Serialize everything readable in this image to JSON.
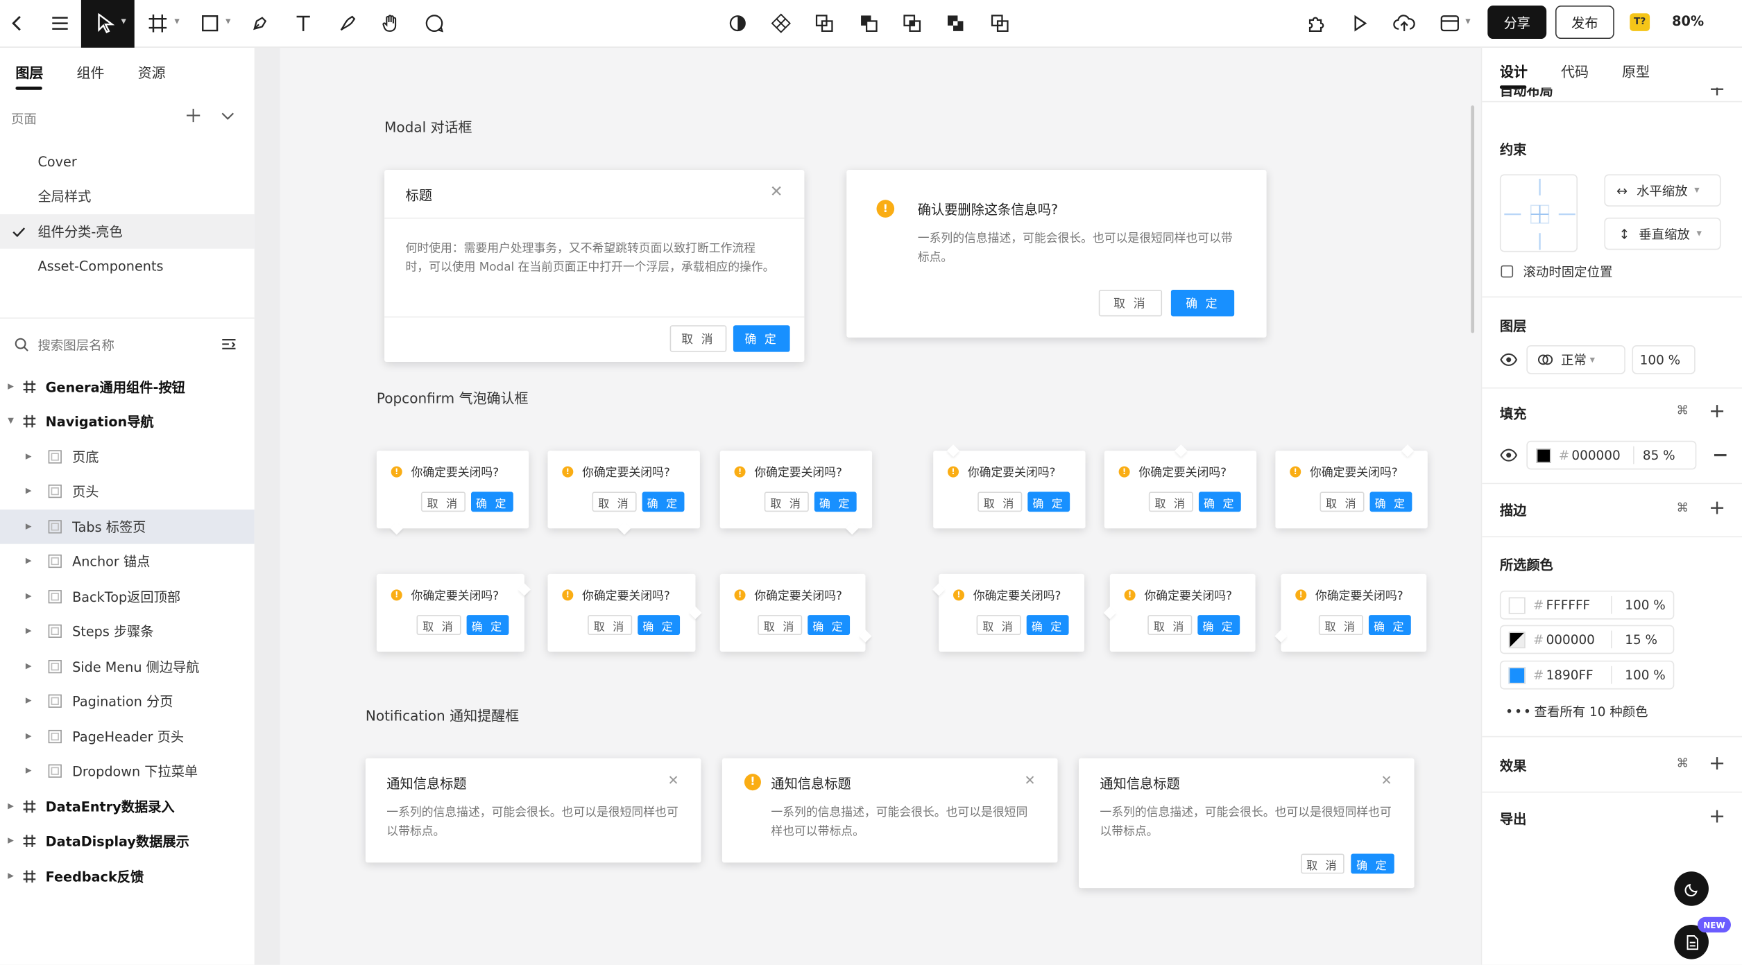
{
  "toolbar": {
    "share_label": "分享",
    "publish_label": "发布",
    "zoom": "80%",
    "font_badge": "T?"
  },
  "left": {
    "tabs": [
      "图层",
      "组件",
      "资源"
    ],
    "pages_label": "页面",
    "pages": [
      "Cover",
      "全局样式",
      "组件分类-亮色",
      "Asset-Components"
    ],
    "search_placeholder": "搜索图层名称",
    "layers": [
      "Genera通用组件-按钮",
      "Navigation导航",
      "页底",
      "页头",
      "Tabs 标签页",
      "Anchor 锚点",
      "BackTop返回顶部",
      "Steps 步骤条",
      "Side Menu 侧边导航",
      "Pagination 分页",
      "PageHeader 页头",
      "Dropdown 下拉菜单",
      "DataEntry数据录入",
      "DataDisplay数据展示",
      "Feedback反馈"
    ]
  },
  "canvas": {
    "modal_section": "Modal 对话框",
    "modal1": {
      "title": "标题",
      "body": "何时使用：需要用户处理事务，又不希望跳转页面以致打断工作流程时，可以使用 Modal 在当前页面正中打开一个浮层，承载相应的操作。",
      "cancel": "取 消",
      "ok": "确 定"
    },
    "modal2": {
      "title": "确认要删除这条信息吗?",
      "body": "一系列的信息描述，可能会很长。也可以是很短同样也可以带标点。",
      "cancel": "取 消",
      "ok": "确 定"
    },
    "pop_section": "Popconfirm 气泡确认框",
    "pop_question": "你确定要关闭吗?",
    "pop_cancel": "取 消",
    "pop_ok": "确 定",
    "notif_section": "Notification 通知提醒框",
    "notif_title": "通知信息标题",
    "notif_body": "一系列的信息描述，可能会很长。也可以是很短同样也可以带标点。",
    "notif_cancel": "取 消",
    "notif_ok": "确 定"
  },
  "right": {
    "tabs": [
      "设计",
      "代码",
      "原型"
    ],
    "autolayout": "自动布局",
    "constraint": "约束",
    "h_scale": "水平缩放",
    "v_scale": "垂直缩放",
    "fix_on_scroll": "滚动时固定位置",
    "layer": "图层",
    "blend_mode": "正常",
    "layer_opacity": "100 %",
    "fill": "填充",
    "fill_hex": "000000",
    "fill_opacity": "85 %",
    "stroke": "描边",
    "selected_colors": "所选颜色",
    "colors": [
      {
        "hex": "FFFFFF",
        "opacity": "100 %",
        "swatch": "#FFFFFF"
      },
      {
        "hex": "000000",
        "opacity": "15 %",
        "swatch": "#000000"
      },
      {
        "hex": "1890FF",
        "opacity": "100 %",
        "swatch": "#1890FF"
      }
    ],
    "view_all_colors": "查看所有 10 种颜色",
    "effects": "效果",
    "export": "导出",
    "new_badge": "NEW"
  }
}
